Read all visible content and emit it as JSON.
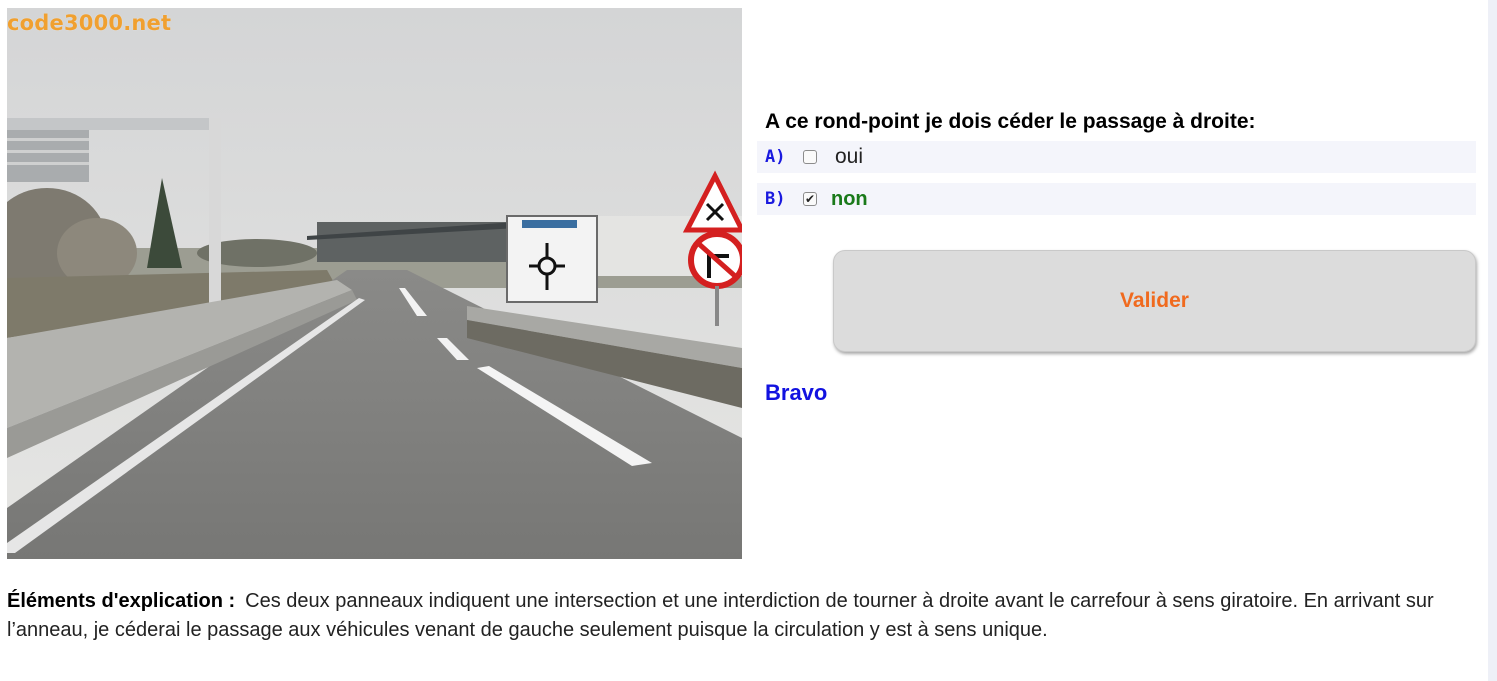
{
  "photo": {
    "watermark": "code3000.net",
    "description_icons": [
      "intersection-warning-sign",
      "no-right-turn-sign",
      "roundabout-direction-sign"
    ]
  },
  "question": {
    "text": "A ce rond-point je dois céder le passage à droite:"
  },
  "answers": [
    {
      "letter": "A)",
      "text": "oui",
      "checked": false
    },
    {
      "letter": "B)",
      "text": "non",
      "checked": true
    }
  ],
  "validate_label": "Valider",
  "result_text": "Bravo",
  "explanation": {
    "label": "Éléments d'explication :",
    "text": "Ces deux panneaux indiquent une intersection et une interdiction de tourner à droite avant le carrefour à sens giratoire. En arrivant sur l’anneau, je céderai le passage aux véhicules venant de gauche seulement puisque la circulation y est à sens unique."
  },
  "colors": {
    "answer_letter": "#1a1adf",
    "correct_answer": "#1a7a1a",
    "validate_text": "#f06a1e",
    "result": "#1212e0",
    "watermark": "#f0a030"
  }
}
